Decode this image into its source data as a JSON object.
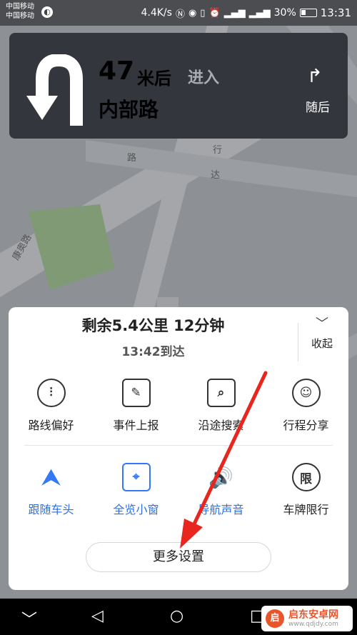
{
  "status_bar": {
    "carrier1": "中国移动",
    "carrier2": "中国移动",
    "speed": "4.4K/s",
    "signal1": "46",
    "signal2": "26",
    "battery": "30%",
    "time": "13:31"
  },
  "map": {
    "labels": [
      "路",
      "达",
      "康奥路",
      "行"
    ]
  },
  "nav": {
    "distance": "47",
    "unit": "米后",
    "action": "进入",
    "road": "内部路",
    "next_label": "随后",
    "turn_icon": "u-turn-icon",
    "next_icon": "turn-right-icon"
  },
  "panel": {
    "remaining": "剩余5.4公里 12分钟",
    "arrival": "13:42到达",
    "collapse_label": "收起",
    "row1": [
      {
        "label": "路线偏好",
        "icon": "sliders-icon"
      },
      {
        "label": "事件上报",
        "icon": "report-icon"
      },
      {
        "label": "沿途搜索",
        "icon": "map-search-icon"
      },
      {
        "label": "行程分享",
        "icon": "share-icon"
      }
    ],
    "row2": [
      {
        "label": "跟随车头",
        "icon": "heading-arrow-icon"
      },
      {
        "label": "全览小窗",
        "icon": "overview-map-icon"
      },
      {
        "label": "导航声音",
        "icon": "speaker-icon"
      },
      {
        "label": "车牌限行",
        "icon": "restriction-icon",
        "glyph": "限"
      }
    ],
    "more_settings": "更多设置"
  },
  "navbar": {
    "back": "◁",
    "home": "○",
    "recents": "□",
    "down": "﹀"
  },
  "watermark": {
    "title": "启东安卓网",
    "url": "www.qdjdy.com"
  },
  "colors": {
    "accent_blue": "#3478f6",
    "banner_bg": "#33373d",
    "arrow_red": "#e8261e"
  }
}
